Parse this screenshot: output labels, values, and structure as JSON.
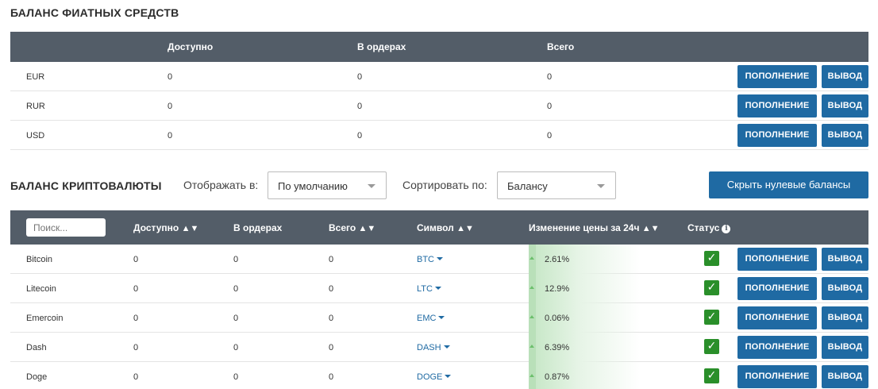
{
  "fiat": {
    "title": "БАЛАНС ФИАТНЫХ СРЕДСТВ",
    "columns": [
      "Доступно",
      "В ордерах",
      "Всего"
    ],
    "rows": [
      {
        "currency": "EUR",
        "available": "0",
        "orders": "0",
        "total": "0"
      },
      {
        "currency": "RUR",
        "available": "0",
        "orders": "0",
        "total": "0"
      },
      {
        "currency": "USD",
        "available": "0",
        "orders": "0",
        "total": "0"
      }
    ]
  },
  "buttons": {
    "deposit": "ПОПОЛНЕНИЕ",
    "withdraw": "ВЫВОД"
  },
  "crypto": {
    "title": "БАЛАНС КРИПТОВАЛЮТЫ",
    "display_label": "Отображать в:",
    "display_value": "По умолчанию",
    "sort_label": "Сортировать по:",
    "sort_value": "Балансу",
    "hide_zero_label": "Скрыть нулевые балансы",
    "search_placeholder": "Поиск...",
    "columns": {
      "available": "Доступно",
      "orders": "В ордерах",
      "total": "Всего",
      "symbol": "Символ",
      "change": "Изменение цены за 24ч",
      "status": "Статус"
    },
    "rows": [
      {
        "name": "Bitcoin",
        "available": "0",
        "orders": "0",
        "total": "0",
        "symbol": "BTC",
        "change": "2.61%"
      },
      {
        "name": "Litecoin",
        "available": "0",
        "orders": "0",
        "total": "0",
        "symbol": "LTC",
        "change": "12.9%"
      },
      {
        "name": "Emercoin",
        "available": "0",
        "orders": "0",
        "total": "0",
        "symbol": "EMC",
        "change": "0.06%"
      },
      {
        "name": "Dash",
        "available": "0",
        "orders": "0",
        "total": "0",
        "symbol": "DASH",
        "change": "6.39%"
      },
      {
        "name": "Doge",
        "available": "0",
        "orders": "0",
        "total": "0",
        "symbol": "DOGE",
        "change": "0.87%"
      }
    ]
  },
  "icons": {
    "sort": "sort-arrows-icon",
    "info": "info-icon",
    "check": "checkmark-icon",
    "dropdown": "caret-down-icon"
  },
  "colors": {
    "header_bg": "#535d68",
    "button_bg": "#1f6aa3",
    "status_ok": "#2a8f2a",
    "change_up": "#c4e6c4"
  }
}
